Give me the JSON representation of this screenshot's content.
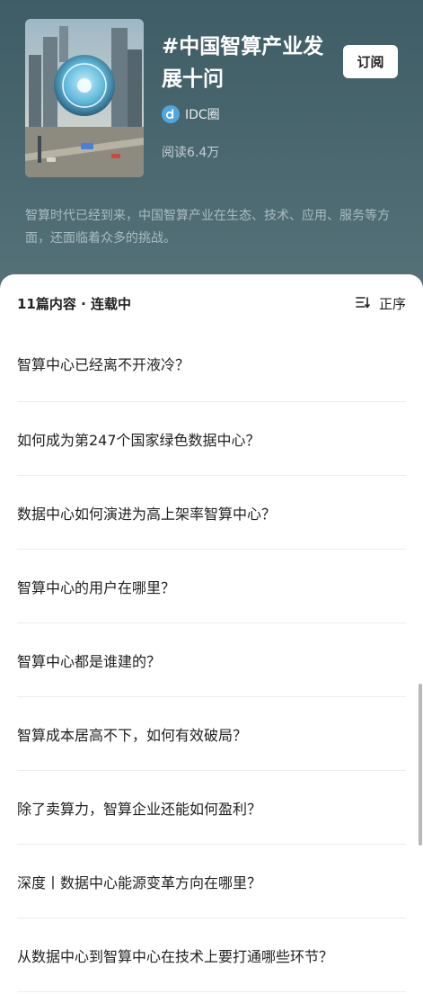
{
  "header": {
    "title": "#中国智算产业发展十问",
    "subscribe_label": "订阅",
    "author": "IDC圈",
    "reads": "阅读6.4万",
    "description": "智算时代已经到来，中国智算产业在生态、技术、应用、服务等方面，还面临着众多的挑战。"
  },
  "list": {
    "count_label": "11篇内容 · 连载中",
    "sort_label": "正序",
    "items": [
      "智算中心已经离不开液冷？",
      "如何成为第247个国家绿色数据中心？",
      "数据中心如何演进为高上架率智算中心？",
      "智算中心的用户在哪里？",
      "智算中心都是谁建的？",
      "智算成本居高不下，如何有效破局？",
      "除了卖算力，智算企业还能如何盈利？",
      "深度丨数据中心能源变革方向在哪里？",
      "从数据中心到智算中心在技术上要打通哪些环节？"
    ]
  },
  "colors": {
    "header_bg": "#4b6870",
    "subscribe_bg": "#ffffff",
    "author_logo": "#4fa6e0"
  }
}
